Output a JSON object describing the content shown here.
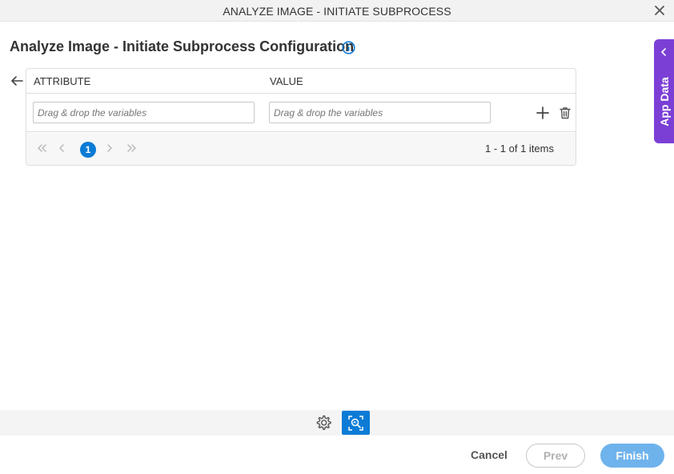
{
  "window": {
    "title": "ANALYZE IMAGE - INITIATE SUBPROCESS",
    "close_icon": "close-icon"
  },
  "page": {
    "heading": "Analyze Image - Initiate Subprocess Configuration",
    "info_icon": "info-icon"
  },
  "grid": {
    "columns": [
      "ATTRIBUTE",
      "VALUE"
    ],
    "rows": [
      {
        "attribute_placeholder": "Drag & drop the variables",
        "value_placeholder": "Drag & drop the variables"
      }
    ],
    "pager": {
      "current_page": "1",
      "info": "1 - 1 of 1 items"
    }
  },
  "side_panel": {
    "label": "App Data",
    "color": "#7b3fd6"
  },
  "toolbar": {
    "icons": [
      "gear-icon",
      "image-search-icon"
    ],
    "active_color": "#0b7bd6"
  },
  "footer": {
    "cancel_label": "Cancel",
    "prev_label": "Prev",
    "finish_label": "Finish"
  },
  "colors": {
    "accent": "#0b7bd6",
    "finish_button": "#6fb3ec"
  }
}
